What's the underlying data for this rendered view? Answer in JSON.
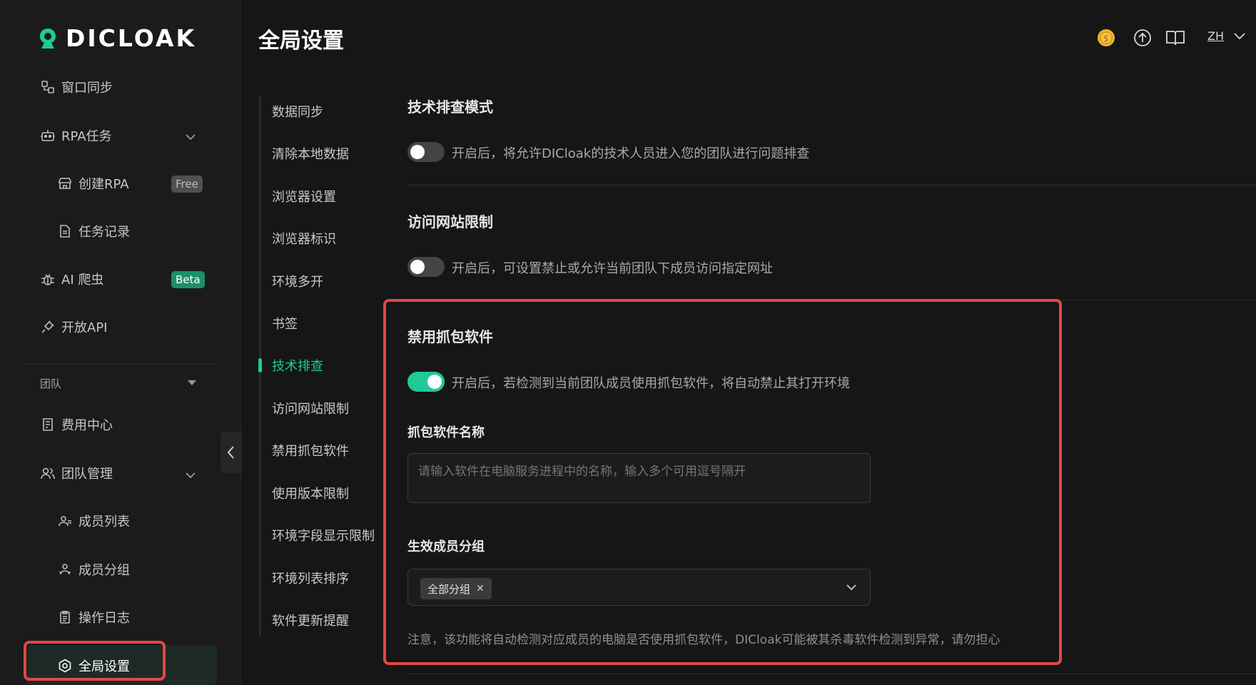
{
  "app": {
    "logo_text": "DICLOAK",
    "page_title": "全局设置"
  },
  "colors": {
    "accent": "#20c997",
    "highlight": "#e04848",
    "background": "#161616"
  },
  "sidebar": {
    "items": [
      {
        "label": "窗口同步",
        "icon": "window-sync-icon"
      },
      {
        "label": "RPA任务",
        "icon": "robot-icon",
        "expandable": true
      },
      {
        "label": "创建RPA",
        "icon": "store-icon",
        "badge": "Free"
      },
      {
        "label": "任务记录",
        "icon": "document-icon"
      },
      {
        "label": "AI 爬虫",
        "icon": "bug-icon",
        "badge": "Beta"
      },
      {
        "label": "开放API",
        "icon": "plug-icon"
      }
    ],
    "team_section": "团队",
    "team_items": [
      {
        "label": "费用中心",
        "icon": "billing-icon"
      },
      {
        "label": "团队管理",
        "icon": "team-icon",
        "expandable": true
      },
      {
        "label": "成员列表",
        "icon": "member-icon"
      },
      {
        "label": "成员分组",
        "icon": "group-icon"
      },
      {
        "label": "操作日志",
        "icon": "clipboard-icon"
      },
      {
        "label": "全局设置",
        "icon": "settings-icon",
        "active": true
      }
    ]
  },
  "header": {
    "icons": [
      "coin-icon",
      "upload-icon",
      "book-icon"
    ],
    "language": "ZH"
  },
  "settings_nav": {
    "items": [
      "数据同步",
      "清除本地数据",
      "浏览器设置",
      "浏览器标识",
      "环境多开",
      "书签",
      "技术排查",
      "访问网站限制",
      "禁用抓包软件",
      "使用版本限制",
      "环境字段显示限制",
      "环境列表排序",
      "软件更新提醒"
    ],
    "active": "技术排查"
  },
  "sections": {
    "tech_debug": {
      "title": "技术排查模式",
      "toggle_on": false,
      "desc": "开启后，将允许DICloak的技术人员进入您的团队进行问题排查"
    },
    "site_limit": {
      "title": "访问网站限制",
      "toggle_on": false,
      "desc": "开启后，可设置禁止或允许当前团队下成员访问指定网址"
    },
    "packet_capture": {
      "title": "禁用抓包软件",
      "toggle_on": true,
      "desc": "开启后，若检测到当前团队成员使用抓包软件，将自动禁止其打开环境",
      "name_label": "抓包软件名称",
      "name_placeholder": "请输入软件在电脑服务进程中的名称，输入多个可用逗号隔开",
      "group_label": "生效成员分组",
      "group_tag": "全部分组",
      "note": "注意，该功能将自动检测对应成员的电脑是否使用抓包软件，DICloak可能被其杀毒软件检测到异常，请勿担心"
    }
  }
}
